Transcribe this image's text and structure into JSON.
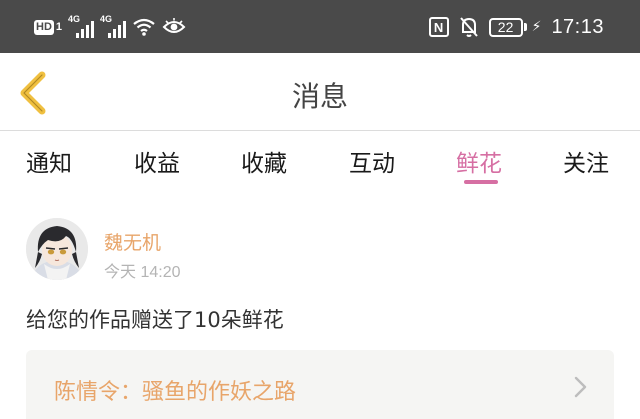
{
  "status_bar": {
    "hd_label": "HD",
    "sim_number": "1",
    "signal_1_label": "4G",
    "signal_2_label": "4G",
    "nfc_label": "N",
    "battery_level": "22",
    "time": "17:13",
    "icons": [
      "hd-icon",
      "signal-icon",
      "signal-icon",
      "wifi-icon",
      "eye-icon",
      "nfc-icon",
      "mute-bell-icon",
      "battery-icon",
      "charging-bolt-icon"
    ]
  },
  "header": {
    "title": "消息",
    "back_icon": "chevron-left-icon",
    "back_color": "#f0c040"
  },
  "tabs": [
    {
      "label": "通知",
      "active": false
    },
    {
      "label": "收益",
      "active": false
    },
    {
      "label": "收藏",
      "active": false
    },
    {
      "label": "互动",
      "active": false
    },
    {
      "label": "鲜花",
      "active": true
    },
    {
      "label": "关注",
      "active": false
    }
  ],
  "accent_color": "#d66fa3",
  "message": {
    "sender": "魏无机",
    "time": "今天 14:20",
    "body": "给您的作品赠送了10朵鲜花",
    "work_title": "陈情令：骚鱼的作妖之路",
    "work_title_color": "#e8a56a"
  }
}
